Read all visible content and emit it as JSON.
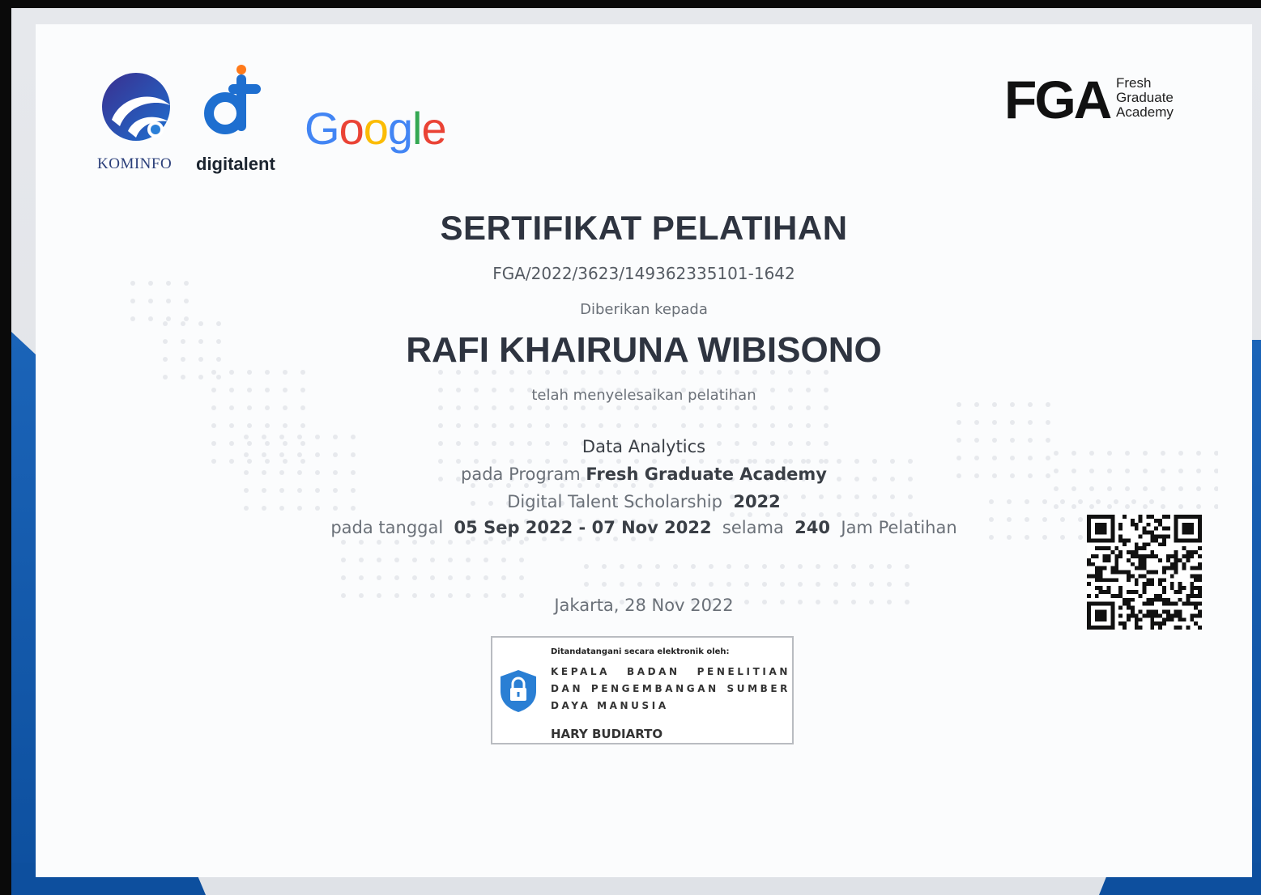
{
  "logos": {
    "kominfo_label": "KOMINFO",
    "digitalent_label": "digitalent",
    "google_letters": [
      "G",
      "o",
      "o",
      "g",
      "l",
      "e"
    ],
    "google_colors": [
      "#4285f4",
      "#ea4335",
      "#fbbc05",
      "#4285f4",
      "#34a853",
      "#ea4335"
    ],
    "fga_mark": "FGA",
    "fga_sub": [
      "Fresh",
      "Graduate",
      "Academy"
    ]
  },
  "certificate": {
    "title": "SERTIFIKAT PELATIHAN",
    "number": "FGA/2022/3623/149362335101-1642",
    "given_to_label": "Diberikan kepada",
    "recipient": "RAFI KHAIRUNA WIBISONO",
    "completed_label": "telah menyelesaikan pelatihan",
    "course": "Data Analytics",
    "program_prefix": "pada Program",
    "program_name": "Fresh Graduate Academy",
    "scholarship": "Digital Talent Scholarship",
    "year": "2022",
    "date_prefix": "pada tanggal",
    "date_range": "05 Sep 2022 - 07 Nov 2022",
    "duration_prefix": "selama",
    "hours": "240",
    "hours_suffix": "Jam Pelatihan",
    "place_date": "Jakarta, 28 Nov 2022"
  },
  "signature": {
    "label": "Ditandatangani secara elektronik oleh:",
    "position": "KEPALA BADAN PENELITIAN DAN PENGEMBANGAN SUMBER DAYA MANUSIA",
    "name": "HARY BUDIARTO",
    "shield_color": "#2a7fd4"
  },
  "colors": {
    "accent_blue": "#0d4f9e",
    "text_dark": "#2e3440"
  }
}
